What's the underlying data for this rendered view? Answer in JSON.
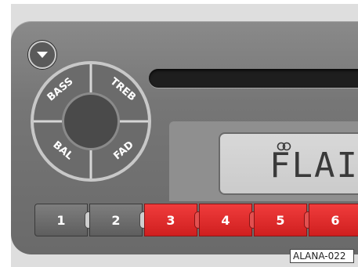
{
  "knob": {
    "bass_label": "BASS",
    "treb_label": "TREB",
    "bal_label": "BAL",
    "fad_label": "FAD"
  },
  "display": {
    "text": "FLAI"
  },
  "presets": [
    {
      "label": "1",
      "color": "gray"
    },
    {
      "label": "2",
      "color": "gray"
    },
    {
      "label": "3",
      "color": "red"
    },
    {
      "label": "4",
      "color": "red"
    },
    {
      "label": "5",
      "color": "red"
    },
    {
      "label": "6",
      "color": "red"
    }
  ],
  "reference_code": "ALANA-022",
  "colors": {
    "preset_red": "#e02626",
    "preset_gray": "#6b6b6b",
    "faceplate": "#787878"
  },
  "icons": {
    "eject": "eject-icon",
    "lcd_indicator": "stereo-indicator-icon"
  }
}
